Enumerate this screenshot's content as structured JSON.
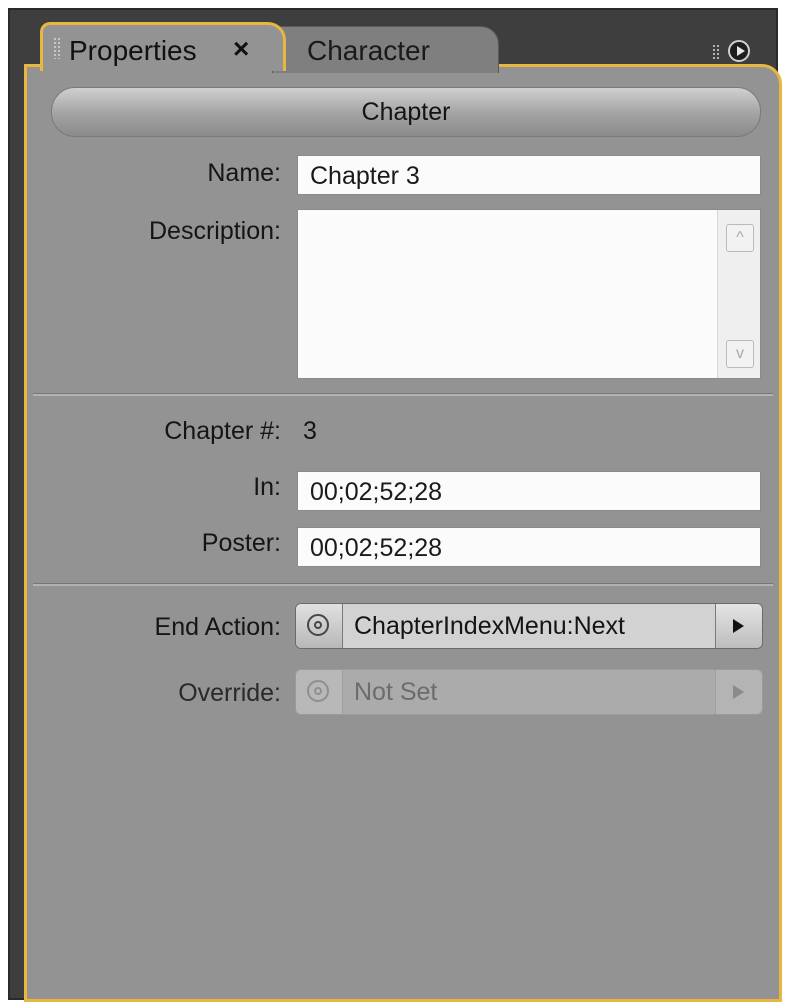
{
  "tabs": [
    {
      "label": "Properties",
      "close": "×",
      "active": true
    },
    {
      "label": "Character",
      "active": false
    }
  ],
  "section": {
    "title": "Chapter"
  },
  "fields": {
    "name": {
      "label": "Name:",
      "value": "Chapter 3"
    },
    "description": {
      "label": "Description:",
      "value": ""
    },
    "chapter_number": {
      "label": "Chapter #:",
      "value": "3"
    },
    "in": {
      "label": "In:",
      "value": "00;02;52;28"
    },
    "poster": {
      "label": "Poster:",
      "value": "00;02;52;28"
    },
    "end_action": {
      "label": "End Action:",
      "value": "ChapterIndexMenu:Next"
    },
    "override": {
      "label": "Override:",
      "value": "Not Set",
      "disabled": true
    }
  },
  "scroll": {
    "up": "^",
    "down": "v"
  },
  "colors": {
    "active_border": "#e7b740",
    "panel_bg": "#939393",
    "frame_bg": "#3e3e3e"
  },
  "icons": [
    "grip-icon",
    "close-icon",
    "panel-menu-icon",
    "link-icon",
    "arrow-right-icon",
    "scroll-up-icon",
    "scroll-down-icon"
  ]
}
